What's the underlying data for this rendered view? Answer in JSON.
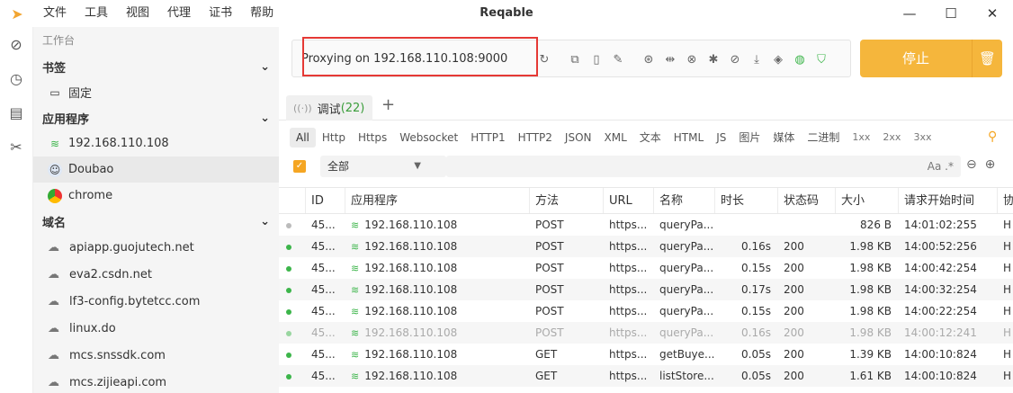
{
  "app": {
    "title": "Reqable",
    "menu": [
      "文件",
      "工具",
      "视图",
      "代理",
      "证书",
      "帮助"
    ]
  },
  "rail": [
    "compass-icon",
    "history-icon",
    "layers-icon",
    "tools-icon"
  ],
  "sidebar": {
    "workspace": "工作台",
    "bookmarks_label": "书签",
    "pinned": "固定",
    "apps_label": "应用程序",
    "apps": [
      "192.168.110.108",
      "Doubao",
      "chrome"
    ],
    "domains_label": "域名",
    "domains": [
      "apiapp.guojutech.net",
      "eva2.csdn.net",
      "lf3-config.bytetcc.com",
      "linux.do",
      "mcs.snssdk.com",
      "mcs.zijieapi.com"
    ]
  },
  "proxy": {
    "status": "Proxying on 192.168.110.108:9000"
  },
  "stop": {
    "label": "停止"
  },
  "tabs": {
    "name": "调试",
    "count": "(22)"
  },
  "filters": [
    "All",
    "Http",
    "Https",
    "Websocket",
    "HTTP1",
    "HTTP2",
    "JSON",
    "XML",
    "文本",
    "HTML",
    "JS",
    "图片",
    "媒体",
    "二进制",
    "1xx",
    "2xx",
    "3xx"
  ],
  "search": {
    "app_filter": "全部",
    "regex": "Aa  .*"
  },
  "table": {
    "headers": [
      "ID",
      "应用程序",
      "方法",
      "URL",
      "名称",
      "时长",
      "状态码",
      "大小",
      "请求开始时间",
      "协"
    ],
    "rows": [
      {
        "id": "45...",
        "app": "192.168.110.108",
        "method": "POST",
        "url": "https...",
        "name": "queryPa...",
        "dur": "",
        "status": "",
        "size": "826 B",
        "time": "14:01:02:255",
        "proto": "H",
        "state": "pending"
      },
      {
        "id": "45...",
        "app": "192.168.110.108",
        "method": "POST",
        "url": "https...",
        "name": "queryPa...",
        "dur": "0.16s",
        "status": "200",
        "size": "1.98 KB",
        "time": "14:00:52:256",
        "proto": "H",
        "state": "ok"
      },
      {
        "id": "45...",
        "app": "192.168.110.108",
        "method": "POST",
        "url": "https...",
        "name": "queryPa...",
        "dur": "0.15s",
        "status": "200",
        "size": "1.98 KB",
        "time": "14:00:42:254",
        "proto": "H",
        "state": "ok"
      },
      {
        "id": "45...",
        "app": "192.168.110.108",
        "method": "POST",
        "url": "https...",
        "name": "queryPa...",
        "dur": "0.17s",
        "status": "200",
        "size": "1.98 KB",
        "time": "14:00:32:254",
        "proto": "H",
        "state": "ok"
      },
      {
        "id": "45...",
        "app": "192.168.110.108",
        "method": "POST",
        "url": "https...",
        "name": "queryPa...",
        "dur": "0.15s",
        "status": "200",
        "size": "1.98 KB",
        "time": "14:00:22:254",
        "proto": "H",
        "state": "ok"
      },
      {
        "id": "45...",
        "app": "192.168.110.108",
        "method": "POST",
        "url": "https...",
        "name": "queryPa...",
        "dur": "0.16s",
        "status": "200",
        "size": "1.98 KB",
        "time": "14:00:12:241",
        "proto": "H",
        "state": "dim"
      },
      {
        "id": "45...",
        "app": "192.168.110.108",
        "method": "GET",
        "url": "https...",
        "name": "getBuye...",
        "dur": "0.05s",
        "status": "200",
        "size": "1.39 KB",
        "time": "14:00:10:824",
        "proto": "H",
        "state": "ok"
      },
      {
        "id": "45...",
        "app": "192.168.110.108",
        "method": "GET",
        "url": "https...",
        "name": "listStore...",
        "dur": "0.05s",
        "status": "200",
        "size": "1.61 KB",
        "time": "14:00:10:824",
        "proto": "H",
        "state": "ok"
      }
    ]
  }
}
